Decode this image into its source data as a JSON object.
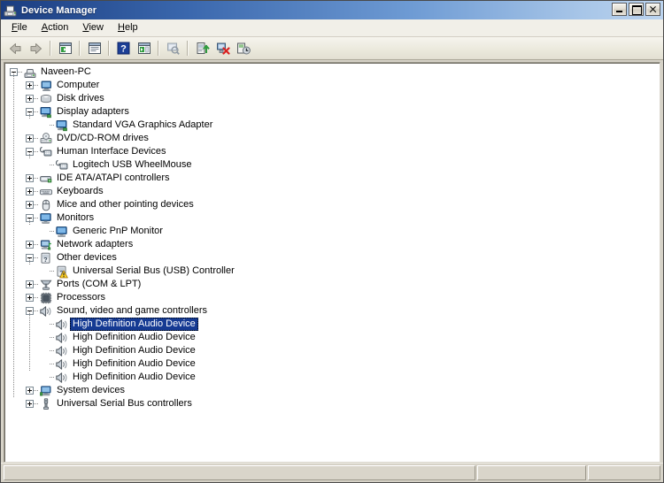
{
  "window": {
    "title": "Device Manager",
    "title_icon": "device-manager-icon",
    "caption": {
      "minimize": "Minimize",
      "maximize": "Maximize",
      "close": "Close"
    }
  },
  "menubar": {
    "items": [
      {
        "label": "File",
        "accel": "F"
      },
      {
        "label": "Action",
        "accel": "A"
      },
      {
        "label": "View",
        "accel": "V"
      },
      {
        "label": "Help",
        "accel": "H"
      }
    ]
  },
  "toolbar": {
    "buttons": [
      {
        "name": "back-icon",
        "tooltip": "Back",
        "enabled": false
      },
      {
        "name": "forward-icon",
        "tooltip": "Forward",
        "enabled": false
      },
      {
        "name": "separator",
        "tooltip": "",
        "enabled": true
      },
      {
        "name": "show-hide-console-tree-icon",
        "tooltip": "Show/Hide Console Tree",
        "enabled": true
      },
      {
        "name": "separator",
        "tooltip": "",
        "enabled": true
      },
      {
        "name": "properties-icon",
        "tooltip": "Properties",
        "enabled": true
      },
      {
        "name": "separator",
        "tooltip": "",
        "enabled": true
      },
      {
        "name": "help-icon",
        "tooltip": "Help",
        "enabled": true
      },
      {
        "name": "show-hide-action-pane-icon",
        "tooltip": "Show/Hide Action Pane",
        "enabled": true
      },
      {
        "name": "separator",
        "tooltip": "",
        "enabled": true
      },
      {
        "name": "scan-for-hardware-changes-icon",
        "tooltip": "Scan for hardware changes",
        "enabled": false
      },
      {
        "name": "separator",
        "tooltip": "",
        "enabled": true
      },
      {
        "name": "update-driver-software-icon",
        "tooltip": "Update Driver Software",
        "enabled": true
      },
      {
        "name": "disable-device-icon",
        "tooltip": "Disable",
        "enabled": true
      },
      {
        "name": "uninstall-device-icon",
        "tooltip": "Uninstall",
        "enabled": true
      }
    ]
  },
  "tree": {
    "nodes": [
      {
        "label": "Naveen-PC",
        "depth": 0,
        "expander": "minus",
        "icon": "computer-root-icon",
        "selected": false,
        "warning": false
      },
      {
        "label": "Computer",
        "depth": 1,
        "expander": "plus",
        "icon": "computer-icon",
        "selected": false,
        "warning": false
      },
      {
        "label": "Disk drives",
        "depth": 1,
        "expander": "plus",
        "icon": "disk-drive-icon",
        "selected": false,
        "warning": false
      },
      {
        "label": "Display adapters",
        "depth": 1,
        "expander": "minus",
        "icon": "display-adapter-icon",
        "selected": false,
        "warning": false
      },
      {
        "label": "Standard VGA Graphics Adapter",
        "depth": 2,
        "expander": "none",
        "icon": "display-adapter-icon",
        "selected": false,
        "warning": false
      },
      {
        "label": "DVD/CD-ROM drives",
        "depth": 1,
        "expander": "plus",
        "icon": "dvd-drive-icon",
        "selected": false,
        "warning": false
      },
      {
        "label": "Human Interface Devices",
        "depth": 1,
        "expander": "minus",
        "icon": "hid-icon",
        "selected": false,
        "warning": false
      },
      {
        "label": "Logitech USB WheelMouse",
        "depth": 2,
        "expander": "none",
        "icon": "hid-icon",
        "selected": false,
        "warning": false
      },
      {
        "label": "IDE ATA/ATAPI controllers",
        "depth": 1,
        "expander": "plus",
        "icon": "ide-controller-icon",
        "selected": false,
        "warning": false
      },
      {
        "label": "Keyboards",
        "depth": 1,
        "expander": "plus",
        "icon": "keyboard-icon",
        "selected": false,
        "warning": false
      },
      {
        "label": "Mice and other pointing devices",
        "depth": 1,
        "expander": "plus",
        "icon": "mouse-icon",
        "selected": false,
        "warning": false
      },
      {
        "label": "Monitors",
        "depth": 1,
        "expander": "minus",
        "icon": "monitor-icon",
        "selected": false,
        "warning": false
      },
      {
        "label": "Generic PnP Monitor",
        "depth": 2,
        "expander": "none",
        "icon": "monitor-icon",
        "selected": false,
        "warning": false
      },
      {
        "label": "Network adapters",
        "depth": 1,
        "expander": "plus",
        "icon": "network-adapter-icon",
        "selected": false,
        "warning": false
      },
      {
        "label": "Other devices",
        "depth": 1,
        "expander": "minus",
        "icon": "other-device-icon",
        "selected": false,
        "warning": false
      },
      {
        "label": "Universal Serial Bus (USB) Controller",
        "depth": 2,
        "expander": "none",
        "icon": "other-device-icon",
        "selected": false,
        "warning": true
      },
      {
        "label": "Ports (COM & LPT)",
        "depth": 1,
        "expander": "plus",
        "icon": "port-icon",
        "selected": false,
        "warning": false
      },
      {
        "label": "Processors",
        "depth": 1,
        "expander": "plus",
        "icon": "processor-icon",
        "selected": false,
        "warning": false
      },
      {
        "label": "Sound, video and game controllers",
        "depth": 1,
        "expander": "minus",
        "icon": "sound-icon",
        "selected": false,
        "warning": false
      },
      {
        "label": "High Definition Audio Device",
        "depth": 2,
        "expander": "none",
        "icon": "sound-icon",
        "selected": true,
        "warning": false
      },
      {
        "label": "High Definition Audio Device",
        "depth": 2,
        "expander": "none",
        "icon": "sound-icon",
        "selected": false,
        "warning": false
      },
      {
        "label": "High Definition Audio Device",
        "depth": 2,
        "expander": "none",
        "icon": "sound-icon",
        "selected": false,
        "warning": false
      },
      {
        "label": "High Definition Audio Device",
        "depth": 2,
        "expander": "none",
        "icon": "sound-icon",
        "selected": false,
        "warning": false
      },
      {
        "label": "High Definition Audio Device",
        "depth": 2,
        "expander": "none",
        "icon": "sound-icon",
        "selected": false,
        "warning": false
      },
      {
        "label": "System devices",
        "depth": 1,
        "expander": "plus",
        "icon": "system-device-icon",
        "selected": false,
        "warning": false
      },
      {
        "label": "Universal Serial Bus controllers",
        "depth": 1,
        "expander": "plus",
        "icon": "usb-controller-icon",
        "selected": false,
        "warning": false
      }
    ]
  },
  "statusbar": {
    "panes": [
      "",
      "",
      ""
    ]
  },
  "colors": {
    "title_gradient_start": "#1b3d80",
    "title_gradient_end": "#bcd4ef",
    "selection": "#153a93",
    "selection_text": "#ffffff",
    "window_face": "#d6d2c7",
    "tree_background": "#ffffff",
    "warning_badge": "#ffd21e"
  }
}
